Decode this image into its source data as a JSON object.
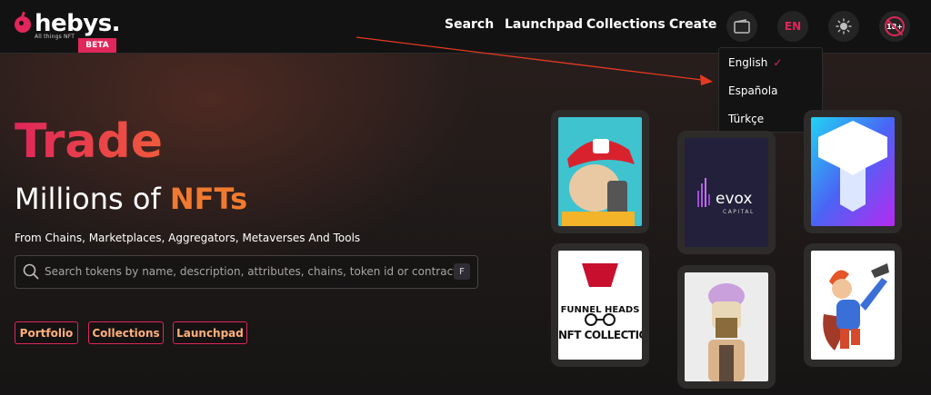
{
  "header": {
    "logo_text": "hebys.",
    "logo_tagline": "All things NFT",
    "beta_label": "BETA",
    "nav": [
      "Search",
      "Launchpad",
      "Collections",
      "Create"
    ],
    "language_code": "EN",
    "age_badge": "18+"
  },
  "language_dropdown": {
    "items": [
      "English",
      "Española",
      "Türkçe"
    ],
    "selected": "English"
  },
  "hero": {
    "headline": "Trade",
    "subheadline_prefix": "Millions of",
    "subheadline_accent": "NFTs",
    "tagline": "From Chains, Marketplaces, Aggregators, Metaverses And Tools",
    "search_placeholder": "Search tokens by name, description, attributes, chains, token id or contract",
    "search_shortcut": "F",
    "quick_links": [
      "Portfolio",
      "Collections",
      "Launchpad"
    ]
  },
  "cards": {
    "evox_name": "evox",
    "evox_sub": "CAPITAL",
    "funnel_title": "FUNNEL HEADS",
    "funnel_caption": "NFT COLLECTION"
  },
  "colors": {
    "accent": "#e0265a",
    "orange": "#f07a30"
  }
}
